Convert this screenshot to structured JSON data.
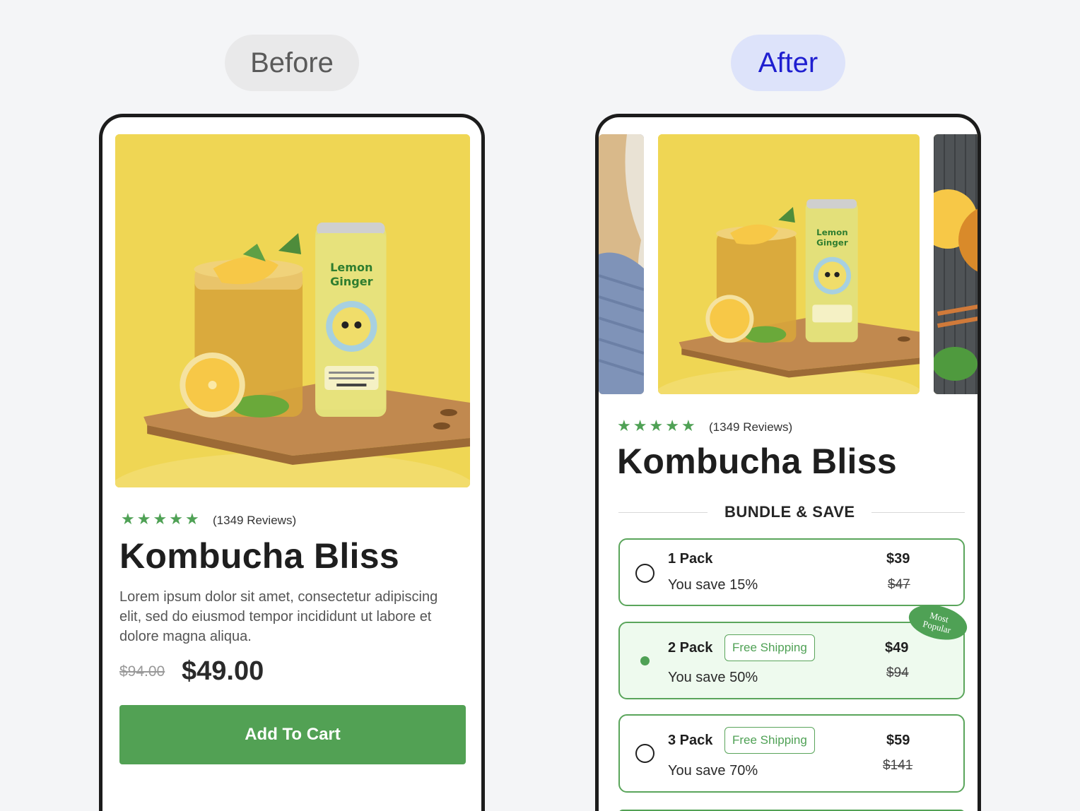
{
  "labels": {
    "before": "Before",
    "after": "After"
  },
  "product": {
    "reviews": "(1349 Reviews)",
    "stars": 5,
    "title": "Kombucha Bliss",
    "description": "Lorem ipsum dolor sit amet, consectetur adipiscing elit, sed do eiusmod tempor incididunt ut labore et dolore magna aliqua.",
    "old_price": "$94.00",
    "price": "$49.00",
    "cta": "Add To Cart",
    "can_label_1": "Lemon",
    "can_label_2": "Ginger"
  },
  "bundle": {
    "title": "BUNDLE & SAVE",
    "badge": {
      "line1": "Most",
      "line2": "Popular"
    },
    "options": [
      {
        "name": "1 Pack",
        "save": "You save 15%",
        "price": "$39",
        "old": "$47",
        "free_shipping": "",
        "selected": false
      },
      {
        "name": "2 Pack",
        "save": "You save 50%",
        "price": "$49",
        "old": "$94",
        "free_shipping": "Free Shipping",
        "selected": true
      },
      {
        "name": "3 Pack",
        "save": "You save 70%",
        "price": "$59",
        "old": "$141",
        "free_shipping": "Free Shipping",
        "selected": false
      }
    ]
  },
  "colors": {
    "accent": "#52a154",
    "image_bg": "#efd654",
    "after_pill": "#dde3fa",
    "after_text": "#1f1fd0"
  }
}
